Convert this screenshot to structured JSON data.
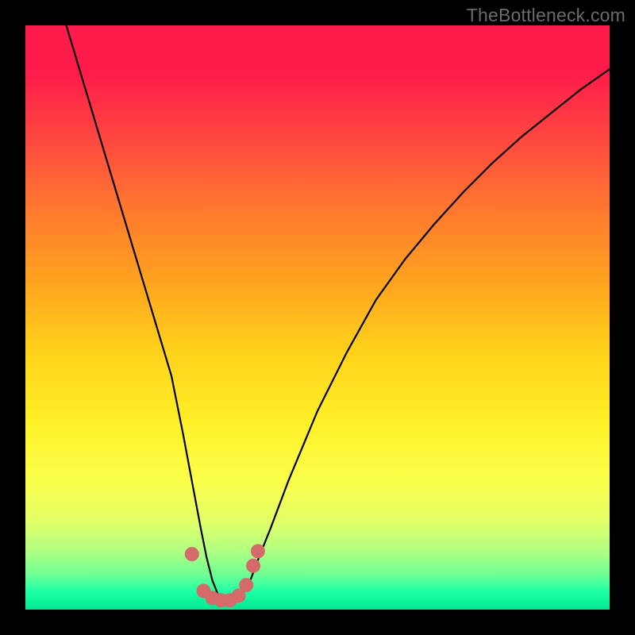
{
  "watermark": "TheBottleneck.com",
  "chart_data": {
    "type": "line",
    "title": "",
    "xlabel": "",
    "ylabel": "",
    "xlim": [
      0,
      100
    ],
    "ylim": [
      0,
      100
    ],
    "series": [
      {
        "name": "bottleneck-curve",
        "x": [
          7,
          10,
          13,
          16,
          19,
          22,
          25,
          27,
          28.5,
          30,
          31,
          32,
          33,
          34,
          35,
          36,
          37,
          38.5,
          40,
          42,
          45,
          50,
          55,
          60,
          65,
          70,
          75,
          80,
          85,
          90,
          95,
          100
        ],
        "y": [
          100,
          90,
          80,
          70,
          60,
          50,
          40,
          30,
          22,
          14,
          9,
          5,
          2.5,
          1.5,
          1.2,
          1.5,
          2.5,
          5,
          9,
          14,
          22,
          34,
          44,
          53,
          60,
          66,
          71.5,
          76.5,
          81,
          85,
          89,
          92.5
        ]
      }
    ],
    "markers": {
      "name": "highlight-dots",
      "color": "#d46a6a",
      "points": [
        {
          "x": 28.5,
          "y": 9.5
        },
        {
          "x": 30.5,
          "y": 3.2
        },
        {
          "x": 32.0,
          "y": 2.0
        },
        {
          "x": 33.5,
          "y": 1.6
        },
        {
          "x": 35.0,
          "y": 1.6
        },
        {
          "x": 36.5,
          "y": 2.4
        },
        {
          "x": 37.8,
          "y": 4.2
        },
        {
          "x": 39.0,
          "y": 7.5
        },
        {
          "x": 39.8,
          "y": 10.0
        }
      ]
    },
    "background_gradient": {
      "top": "#ff1b4a",
      "mid": "#fff028",
      "bottom": "#00e78f"
    }
  }
}
